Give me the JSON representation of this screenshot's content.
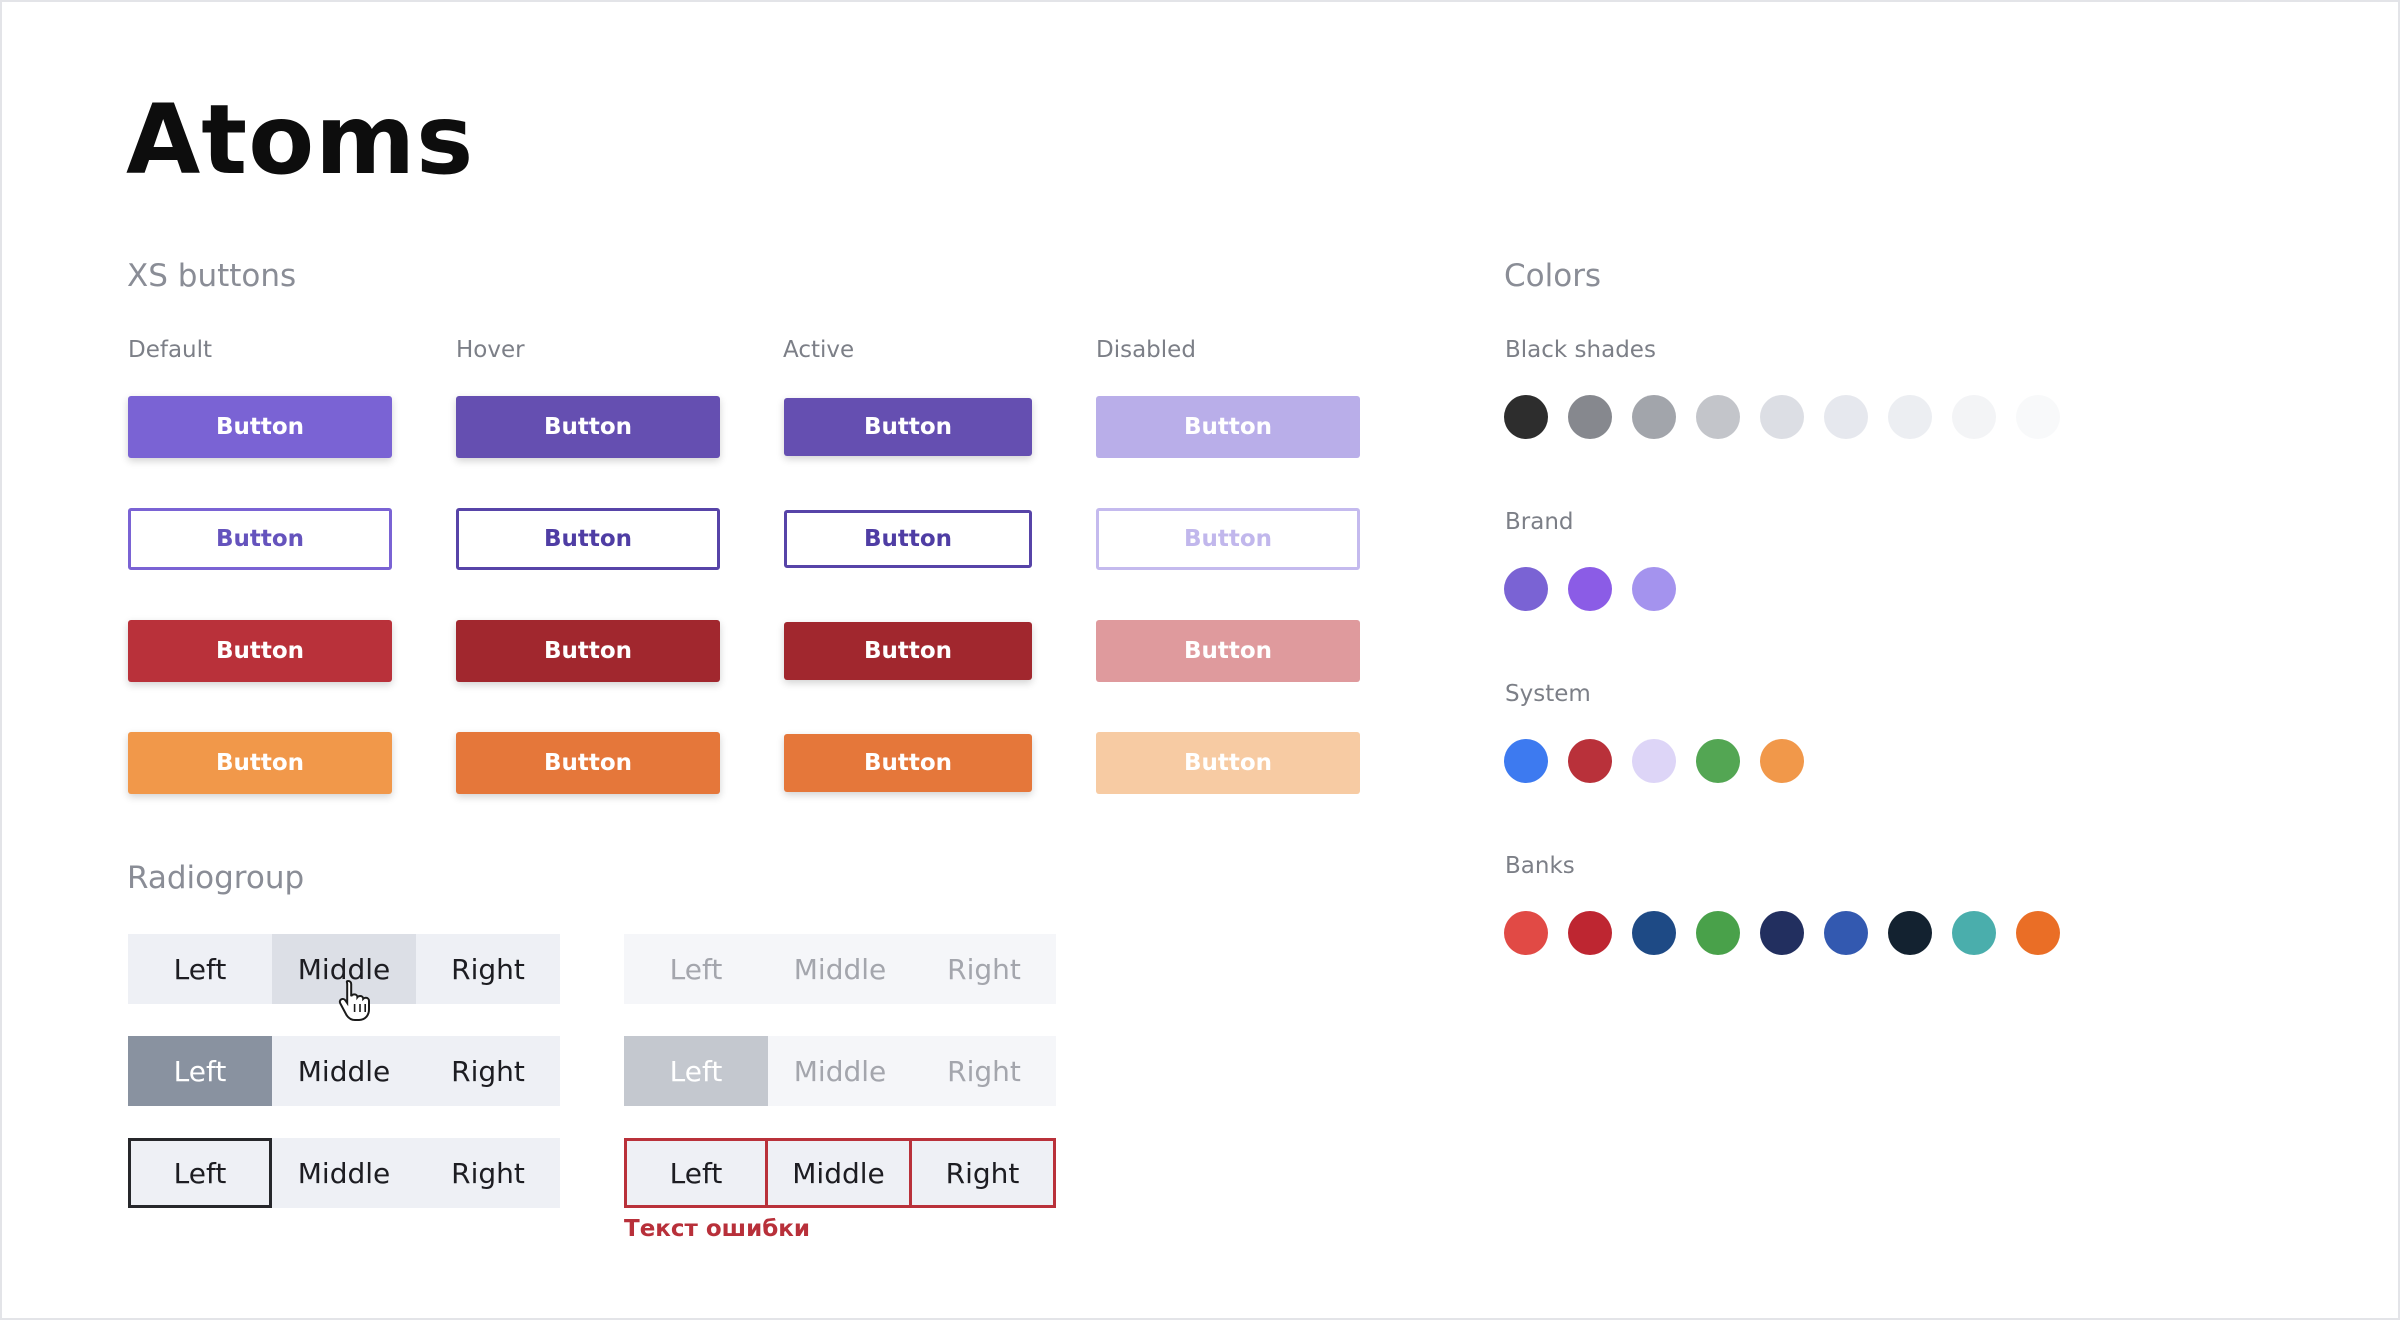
{
  "page": {
    "title": "Atoms"
  },
  "xs_buttons": {
    "title": "XS buttons",
    "states": [
      "Default",
      "Hover",
      "Active",
      "Disabled"
    ],
    "label": "Button",
    "rows": [
      {
        "style": "filled",
        "colors": [
          "#7a63d4",
          "#654fb1",
          "#654fb1",
          "#b9aee9"
        ],
        "text": [
          "#ffffff",
          "#ffffff",
          "#ffffff",
          "#ffffff"
        ]
      },
      {
        "style": "outline",
        "colors": [
          "#7a63d4",
          "#5744a8",
          "#5744a8",
          "#c4baee"
        ],
        "text": [
          "#6553bd",
          "#4f3da4",
          "#4f3da4",
          "#c1b7ec"
        ]
      },
      {
        "style": "filled",
        "colors": [
          "#b9313a",
          "#a1272e",
          "#a1272e",
          "#df9a9d"
        ],
        "text": [
          "#ffffff",
          "#ffffff",
          "#ffffff",
          "#ffffff"
        ]
      },
      {
        "style": "filled",
        "colors": [
          "#f1984a",
          "#e5773a",
          "#e5773a",
          "#f7cba3"
        ],
        "text": [
          "#ffffff",
          "#ffffff",
          "#ffffff",
          "#ffffff"
        ]
      }
    ]
  },
  "radiogroup": {
    "title": "Radiogroup",
    "options": [
      "Left",
      "Middle",
      "Right"
    ],
    "error_text": "Текст ошибки"
  },
  "colors": {
    "title": "Colors",
    "groups": [
      {
        "name": "Black shades",
        "swatches": [
          "#2d2d2d",
          "#86888e",
          "#a2a5ab",
          "#c3c5ca",
          "#dcdee4",
          "#e6e8ee",
          "#eceef2",
          "#f3f4f6",
          "#f8f9fa"
        ]
      },
      {
        "name": "Brand",
        "swatches": [
          "#7a63d4",
          "#8b5ce6",
          "#a493ee"
        ]
      },
      {
        "name": "System",
        "swatches": [
          "#3d7af0",
          "#b9313a",
          "#ddd5f7",
          "#53a653",
          "#f1984a"
        ]
      },
      {
        "name": "Banks",
        "swatches": [
          "#e14a45",
          "#be2631",
          "#1e4a85",
          "#49a14a",
          "#222f5f",
          "#3359b0",
          "#132230",
          "#4aaeac",
          "#ea6e26"
        ]
      }
    ]
  }
}
